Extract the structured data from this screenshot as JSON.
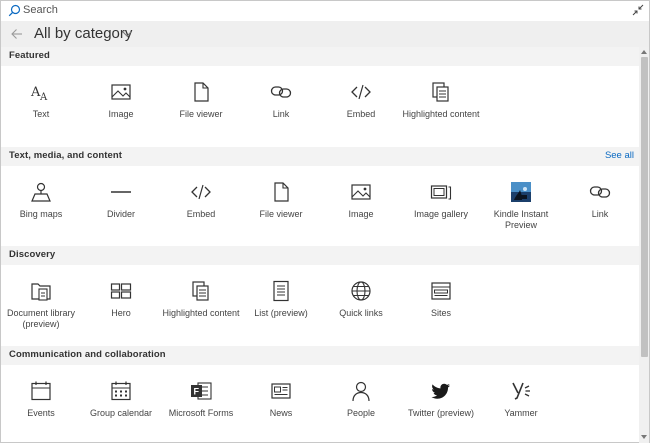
{
  "search": {
    "placeholder": "Search"
  },
  "header": {
    "title": "All by category"
  },
  "colors": {
    "accent": "#0b6ac2",
    "section_bg": "#f3f3f3",
    "header_bg": "#efefef"
  },
  "sections": [
    {
      "label": "Featured",
      "items": [
        {
          "label": "Text",
          "icon": "text-icon"
        },
        {
          "label": "Image",
          "icon": "image-icon"
        },
        {
          "label": "File viewer",
          "icon": "file-icon"
        },
        {
          "label": "Link",
          "icon": "link-icon"
        },
        {
          "label": "Embed",
          "icon": "embed-icon"
        },
        {
          "label": "Highlighted content",
          "icon": "highlighted-content-icon"
        }
      ]
    },
    {
      "label": "Text, media, and content",
      "see_all": "See all",
      "items": [
        {
          "label": "Bing maps",
          "icon": "map-pin-icon"
        },
        {
          "label": "Divider",
          "icon": "divider-icon"
        },
        {
          "label": "Embed",
          "icon": "embed-icon"
        },
        {
          "label": "File viewer",
          "icon": "file-icon"
        },
        {
          "label": "Image",
          "icon": "image-icon"
        },
        {
          "label": "Image gallery",
          "icon": "image-gallery-icon"
        },
        {
          "label": "Kindle Instant Preview",
          "icon": "kindle-icon"
        },
        {
          "label": "Link",
          "icon": "link-icon"
        }
      ]
    },
    {
      "label": "Discovery",
      "items": [
        {
          "label": "Document library (preview)",
          "icon": "document-library-icon"
        },
        {
          "label": "Hero",
          "icon": "hero-icon"
        },
        {
          "label": "Highlighted content",
          "icon": "highlighted-content-icon"
        },
        {
          "label": "List (preview)",
          "icon": "list-icon"
        },
        {
          "label": "Quick links",
          "icon": "globe-icon"
        },
        {
          "label": "Sites",
          "icon": "sites-icon"
        }
      ]
    },
    {
      "label": "Communication and collaboration",
      "items": [
        {
          "label": "Events",
          "icon": "events-icon"
        },
        {
          "label": "Group calendar",
          "icon": "calendar-icon"
        },
        {
          "label": "Microsoft Forms",
          "icon": "forms-icon"
        },
        {
          "label": "News",
          "icon": "news-icon"
        },
        {
          "label": "People",
          "icon": "people-icon"
        },
        {
          "label": "Twitter (preview)",
          "icon": "twitter-icon"
        },
        {
          "label": "Yammer",
          "icon": "yammer-icon"
        }
      ]
    }
  ]
}
